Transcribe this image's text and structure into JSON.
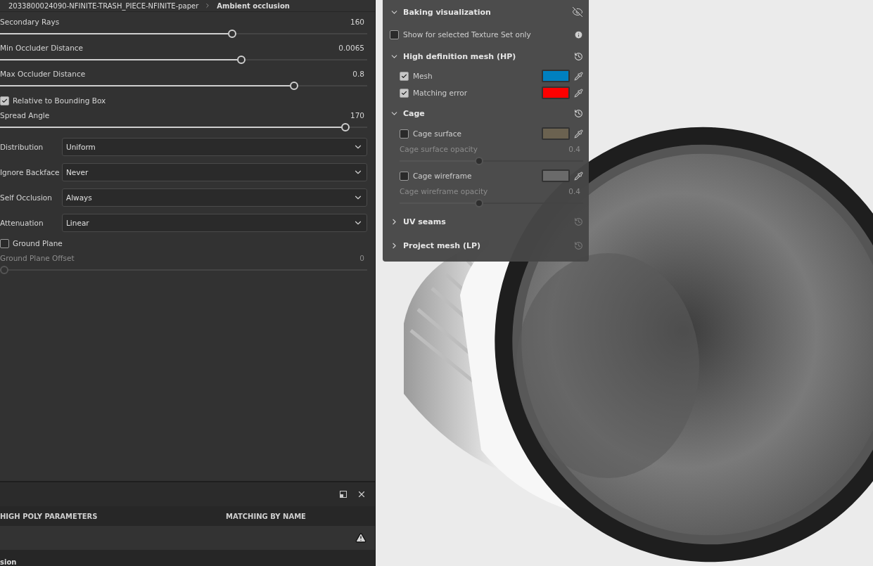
{
  "breadcrumb": {
    "path": "2033800024090-NFINITE-TRASH_PIECE-NFINITE-paper",
    "current": "Ambient occlusion"
  },
  "settings": [
    {
      "kind": "slider",
      "label": "Secondary Rays",
      "reading": "160",
      "level": 0.62,
      "disabled": false
    },
    {
      "kind": "slider",
      "label": "Min Occluder Distance",
      "reading": "0.0065",
      "level": 0.645,
      "disabled": false
    },
    {
      "kind": "slider",
      "label": "Max Occluder Distance",
      "reading": "0.8",
      "level": 0.79,
      "disabled": false
    },
    {
      "kind": "checkbox",
      "label": "Relative to Bounding Box",
      "checked": true
    },
    {
      "kind": "slider",
      "label": "Spread Angle",
      "reading": "170",
      "level": 0.93,
      "disabled": false
    },
    {
      "kind": "select",
      "label": "Distribution",
      "value": "Uniform"
    },
    {
      "kind": "select",
      "label": "Ignore Backface",
      "value": "Never"
    },
    {
      "kind": "select",
      "label": "Self Occlusion",
      "value": "Always"
    },
    {
      "kind": "select",
      "label": "Attenuation",
      "value": "Linear"
    },
    {
      "kind": "checkbox",
      "label": "Ground Plane",
      "checked": false
    },
    {
      "kind": "slider",
      "label": "Ground Plane Offset",
      "reading": "0",
      "level": 0,
      "disabled": true
    }
  ],
  "bottom_panel": {
    "columns": [
      "HIGH POLY PARAMETERS",
      "MATCHING BY NAME"
    ],
    "row_warning": true,
    "last_row": "sion"
  },
  "visualization_panel": {
    "title": "Baking visualization",
    "show_selected_only": {
      "label": "Show for selected Texture Set only",
      "checked": false
    },
    "sections": [
      {
        "title": "High definition mesh (HP)",
        "expanded": true,
        "items": [
          {
            "kind": "color",
            "label": "Mesh",
            "checked": true,
            "color": "#0080c0"
          },
          {
            "kind": "color",
            "label": "Matching error",
            "checked": true,
            "color": "#ff0000"
          }
        ]
      },
      {
        "title": "Cage",
        "expanded": true,
        "items": [
          {
            "kind": "color",
            "label": "Cage surface",
            "checked": false,
            "color": "#6b6250"
          },
          {
            "kind": "slider",
            "label": "Cage surface opacity",
            "reading": "0.4",
            "level": 0.41,
            "disabled": true
          },
          {
            "kind": "color",
            "label": "Cage wireframe",
            "checked": false,
            "color": "#6a6a6a"
          },
          {
            "kind": "slider",
            "label": "Cage wireframe opacity",
            "reading": "0.4",
            "level": 0.41,
            "disabled": true
          }
        ]
      },
      {
        "title": "UV seams",
        "expanded": false
      },
      {
        "title": "Project mesh (LP)",
        "expanded": false
      }
    ]
  }
}
